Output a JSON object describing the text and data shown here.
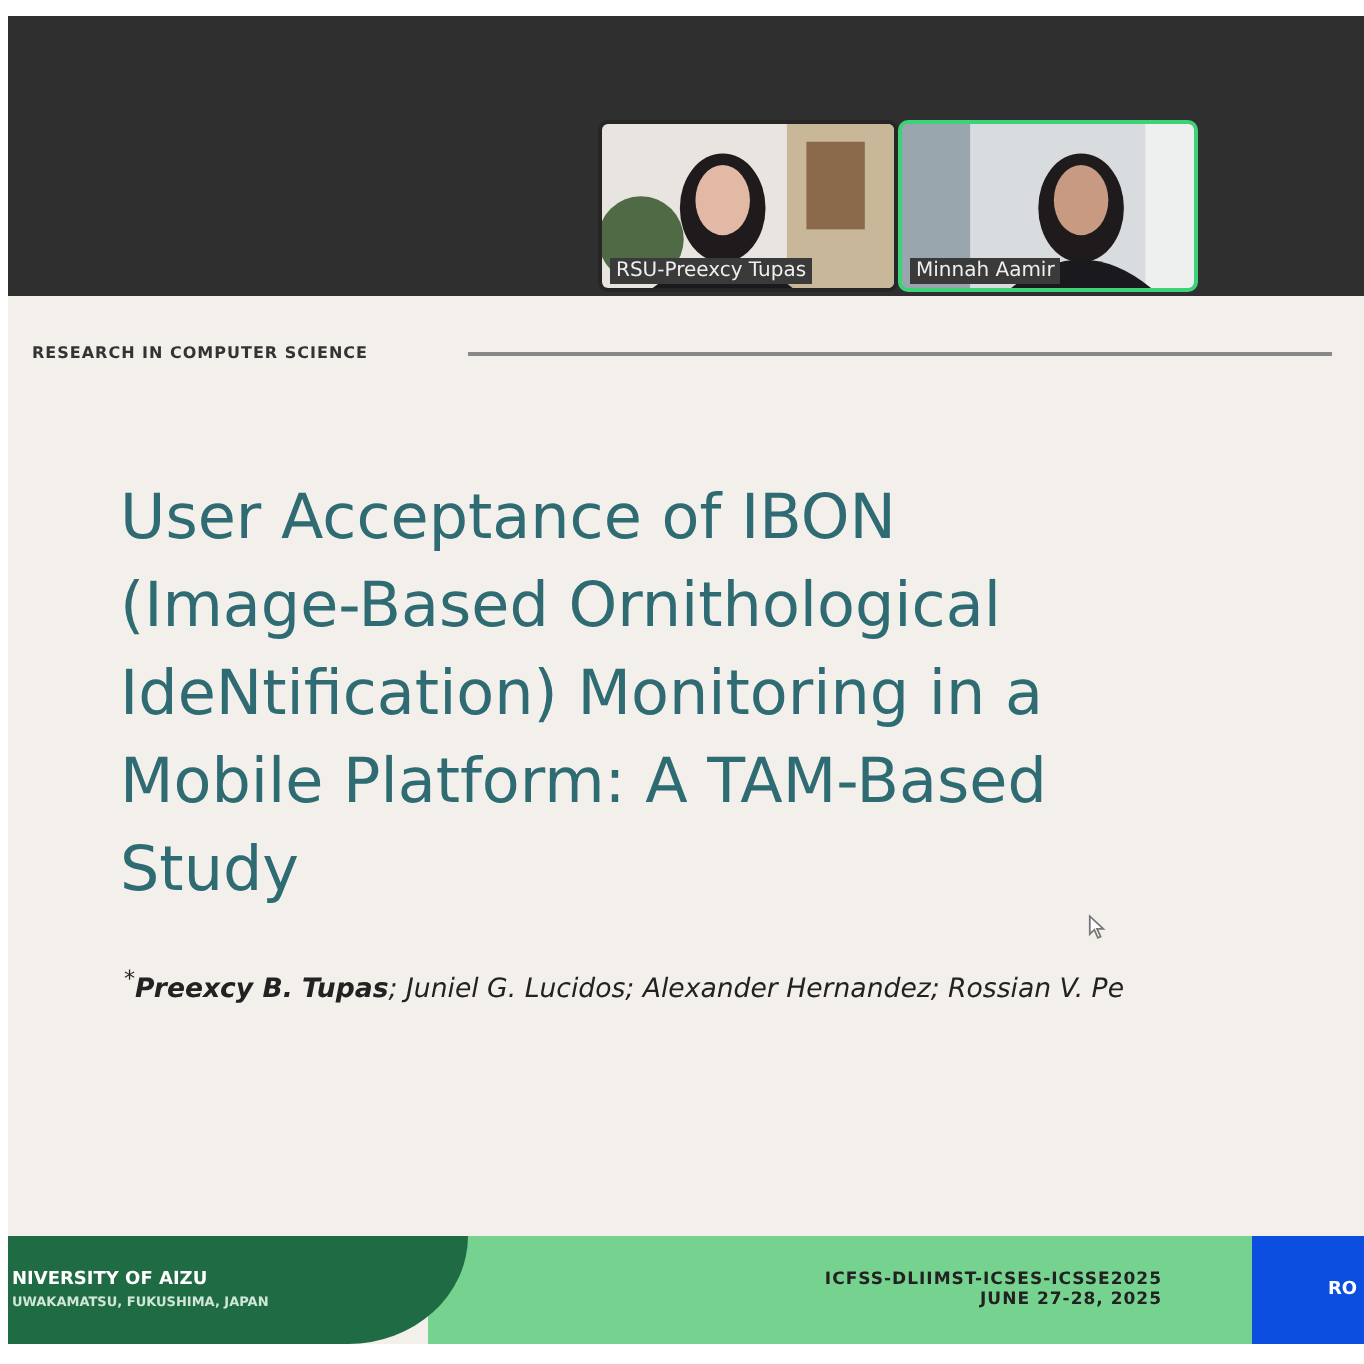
{
  "participants": [
    {
      "name": "RSU-Preexcy Tupas",
      "speaking": false
    },
    {
      "name": "Minnah Aamir",
      "speaking": true
    }
  ],
  "slide": {
    "kicker": "RESEARCH IN COMPUTER SCIENCE",
    "title_lines": [
      "User Acceptance of IBON",
      "(Image-Based Ornithological",
      "IdeNtification) Monitoring in a",
      "Mobile Platform: A TAM-Based",
      "Study"
    ],
    "authors": "$^{*}$**Preexcy B. Tupas**; Juniel G. Lucidos; Alexander Hernandez; Rossian V. Pe",
    "footer": {
      "university": "NIVERSITY OF AIZU",
      "location": "UWAKAMATSU, FUKUSHIMA, JAPAN",
      "conference": "ICFSS-DLIIMST-ICSES-ICSSE2025",
      "dates": "JUNE 27-28, 2025",
      "partner": "RO"
    }
  }
}
